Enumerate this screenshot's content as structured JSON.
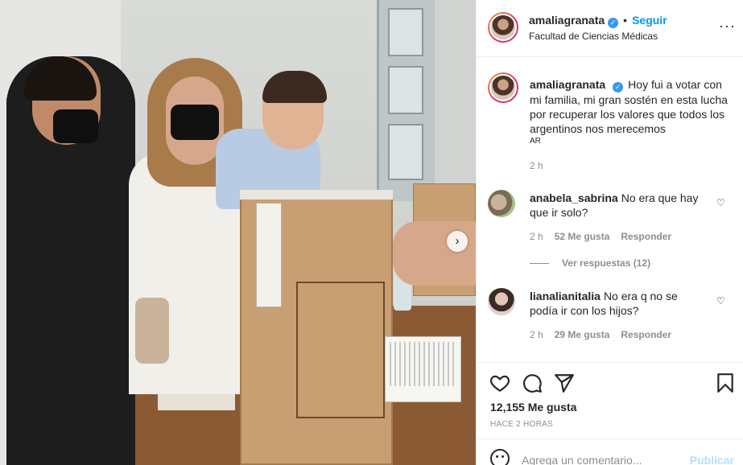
{
  "post": {
    "photo_next_glyph": "›",
    "photo_next_icon": "chevron-right-icon"
  },
  "header": {
    "username": "amaliagranata",
    "verified_glyph": "✓",
    "separator": "•",
    "follow_label": "Seguir",
    "location": "Facultad de Ciencias Médicas",
    "more_glyph": "···"
  },
  "caption": {
    "username": "amaliagranata",
    "text": "Hoy fui a votar con mi familia, mi gran sostén en esta lucha por recuperar los valores que todos los argentinos nos merecemos",
    "region": "AR",
    "time": "2 h"
  },
  "comments": [
    {
      "username": "anabela_sabrina",
      "text": "No era que hay que ir solo?",
      "time": "2 h",
      "likes": "52 Me gusta",
      "reply_label": "Responder",
      "view_replies": "Ver respuestas (12)"
    },
    {
      "username": "lianalianitalia",
      "text": "No era q no se podía ir con los hijos?",
      "time": "2 h",
      "likes": "29 Me gusta",
      "reply_label": "Responder"
    }
  ],
  "actions": {
    "likes": "12,155 Me gusta",
    "time_ago": "HACE 2 HORAS"
  },
  "add_comment": {
    "placeholder": "Agrega un comentario...",
    "publish_label": "Publicar"
  },
  "colors": {
    "accent": "#0095f6",
    "publish_disabled": "#b2dffc",
    "verified": "#3897f0",
    "muted_text": "#8e8e8e"
  }
}
